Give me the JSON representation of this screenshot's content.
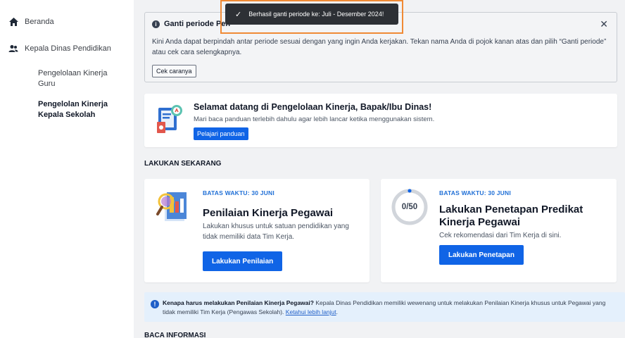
{
  "sidebar": {
    "home_label": "Beranda",
    "role_label": "Kepala Dinas Pendidikan",
    "sub_items": [
      {
        "label": "Pengelolaan Kinerja Guru",
        "active": false
      },
      {
        "label": "Pengelolan Kinerja Kepala Sekolah",
        "active": true
      }
    ]
  },
  "toast": {
    "message": "Berhasil ganti periode ke: Juli - Desember 2024!"
  },
  "banner": {
    "title": "Ganti periode Pen",
    "close_glyph": "✕",
    "body": "Kini Anda dapat berpindah antar periode sesuai dengan yang ingin Anda kerjakan. Tekan nama Anda di pojok kanan atas dan pilih “Ganti periode” atau cek cara selengkapnya.",
    "button_label": "Cek caranya"
  },
  "welcome": {
    "title": "Selamat datang di Pengelolaan Kinerja, Bapak/Ibu Dinas!",
    "subtitle": "Mari baca panduan terlebih dahulu agar lebih lancar ketika menggunakan sistem.",
    "button_label": "Pelajari panduan"
  },
  "section_now": "LAKUKAN SEKARANG",
  "cards": [
    {
      "deadline": "BATAS WAKTU: 30 JUNI",
      "title": "Penilaian Kinerja Pegawai",
      "subtitle": "Lakukan khusus untuk satuan pendidikan yang tidak memiliki data Tim Kerja.",
      "button_label": "Lakukan Penilaian",
      "icon": "magnifier-document-icon"
    },
    {
      "deadline": "BATAS WAKTU: 30 JUNI",
      "title": "Lakukan Penetapan Predikat Kinerja Pegawai",
      "subtitle": "Cek rekomendasi dari Tim Kerja di sini.",
      "button_label": "Lakukan Penetapan",
      "progress_label": "0/50",
      "progress_value": 0
    }
  ],
  "notice": {
    "bold": "Kenapa harus melakukan Penilaian Kinerja Pegawai?",
    "text": " Kepala Dinas Pendidikan memiliki wewenang untuk melakukan Penilaian Kinerja khusus untuk Pegawai yang tidak memiliki Tim Kerja (Pengawas Sekolah). ",
    "link": "Ketahui lebih lanjut",
    "end": "."
  },
  "section_info": "BACA INFORMASI",
  "colors": {
    "primary": "#1064e6",
    "toast_bg": "#2d3035",
    "highlight_frame": "#f08a35",
    "notice_bg": "#e4f0fc"
  }
}
